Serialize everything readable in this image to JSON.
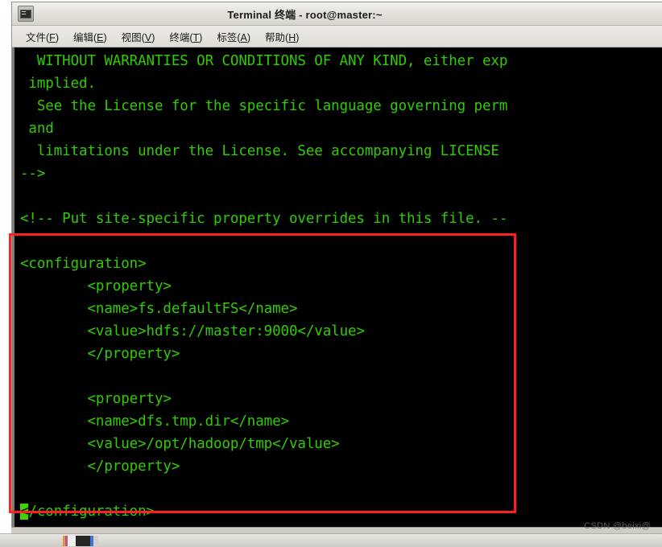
{
  "window": {
    "icon": "terminal-monitor-icon",
    "title": "Terminal 终端  -  root@master:~"
  },
  "menu": {
    "items": [
      {
        "label": "文件(F)",
        "prefix": "文件(",
        "mnemonic": "F",
        "suffix": ")"
      },
      {
        "label": "编辑(E)",
        "prefix": "编辑(",
        "mnemonic": "E",
        "suffix": ")"
      },
      {
        "label": "视图(V)",
        "prefix": "视图(",
        "mnemonic": "V",
        "suffix": ")"
      },
      {
        "label": "终端(T)",
        "prefix": "终端(",
        "mnemonic": "T",
        "suffix": ")"
      },
      {
        "label": "标签(A)",
        "prefix": "标签(",
        "mnemonic": "A",
        "suffix": ")"
      },
      {
        "label": "帮助(H)",
        "prefix": "帮助(",
        "mnemonic": "H",
        "suffix": ")"
      }
    ]
  },
  "terminal": {
    "foreground_color": "#31cc00",
    "background_color": "#000000",
    "cursor_color": "#3fd400",
    "lines": [
      "  WITHOUT WARRANTIES OR CONDITIONS OF ANY KIND, either exp",
      " implied.",
      "  See the License for the specific language governing perm",
      " and",
      "  limitations under the License. See accompanying LICENSE ",
      "-->",
      "",
      "<!-- Put site-specific property overrides in this file. --",
      "",
      "<configuration>",
      "        <property>",
      "        <name>fs.defaultFS</name>",
      "        <value>hdfs://master:9000</value>",
      "        </property>",
      "",
      "        <property>",
      "        <name>dfs.tmp.dir</name>",
      "        <value>/opt/hadoop/tmp</value>",
      "        </property>",
      "",
      "</configuration>"
    ],
    "cursor": {
      "line_index": 20,
      "column": 0,
      "character": "<"
    }
  },
  "annotation": {
    "type": "red-rectangle",
    "color": "#fe2020",
    "covers": "configuration block"
  },
  "watermark": {
    "text": "CSDN @beixi@"
  },
  "taskbar": {
    "item_label": ""
  }
}
